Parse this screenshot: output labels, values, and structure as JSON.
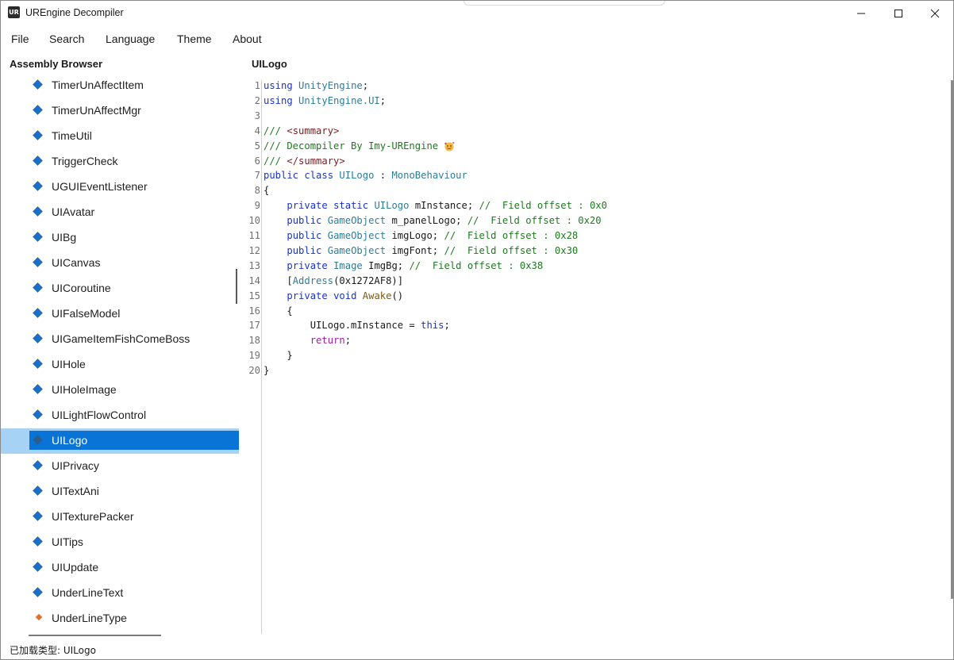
{
  "window": {
    "title": "UREngine Decompiler",
    "icon_text": "UR"
  },
  "menu": [
    "File",
    "Search",
    "Language",
    "Theme",
    "About"
  ],
  "assembly_browser": {
    "title": "Assembly Browser",
    "items": [
      {
        "label": "TimerUnAffectItem",
        "icon": "class-icon"
      },
      {
        "label": "TimerUnAffectMgr",
        "icon": "class-icon"
      },
      {
        "label": "TimeUtil",
        "icon": "class-icon"
      },
      {
        "label": "TriggerCheck",
        "icon": "class-icon"
      },
      {
        "label": "UGUIEventListener",
        "icon": "class-icon"
      },
      {
        "label": "UIAvatar",
        "icon": "class-icon"
      },
      {
        "label": "UIBg",
        "icon": "class-icon"
      },
      {
        "label": "UICanvas",
        "icon": "class-icon"
      },
      {
        "label": "UICoroutine",
        "icon": "class-icon"
      },
      {
        "label": "UIFalseModel",
        "icon": "class-icon"
      },
      {
        "label": "UIGameItemFishComeBoss",
        "icon": "class-icon"
      },
      {
        "label": "UIHole",
        "icon": "class-icon"
      },
      {
        "label": "UIHoleImage",
        "icon": "class-icon"
      },
      {
        "label": "UILightFlowControl",
        "icon": "class-icon"
      },
      {
        "label": "UILogo",
        "icon": "class-icon",
        "selected": true
      },
      {
        "label": "UIPrivacy",
        "icon": "class-icon"
      },
      {
        "label": "UITextAni",
        "icon": "class-icon"
      },
      {
        "label": "UITexturePacker",
        "icon": "class-icon"
      },
      {
        "label": "UITips",
        "icon": "class-icon"
      },
      {
        "label": "UIUpdate",
        "icon": "class-icon"
      },
      {
        "label": "UnderLineText",
        "icon": "class-icon"
      },
      {
        "label": "UnderLineType",
        "icon": "enum-icon"
      }
    ]
  },
  "document": {
    "title": "UILogo",
    "lines": [
      {
        "n": "1",
        "tokens": [
          [
            "kw",
            "using"
          ],
          [
            "pl",
            " "
          ],
          [
            "ty",
            "UnityEngine"
          ],
          [
            "pl",
            ";"
          ]
        ]
      },
      {
        "n": "2",
        "tokens": [
          [
            "kw",
            "using"
          ],
          [
            "pl",
            " "
          ],
          [
            "ty",
            "UnityEngine.UI"
          ],
          [
            "pl",
            ";"
          ]
        ]
      },
      {
        "n": "3",
        "tokens": []
      },
      {
        "n": "4",
        "tokens": [
          [
            "cm",
            "/// "
          ],
          [
            "xml",
            "<summary>"
          ]
        ]
      },
      {
        "n": "5",
        "tokens": [
          [
            "cm",
            "/// Decompiler By Imy-UREngine "
          ]
        ],
        "emoji": true
      },
      {
        "n": "6",
        "tokens": [
          [
            "cm",
            "/// "
          ],
          [
            "xml",
            "</summary>"
          ]
        ]
      },
      {
        "n": "7",
        "tokens": [
          [
            "kw",
            "public"
          ],
          [
            "pl",
            " "
          ],
          [
            "kw",
            "class"
          ],
          [
            "pl",
            " "
          ],
          [
            "ty",
            "UILogo"
          ],
          [
            "pl",
            " : "
          ],
          [
            "ty",
            "MonoBehaviour"
          ]
        ]
      },
      {
        "n": "8",
        "tokens": [
          [
            "pl",
            "{"
          ]
        ]
      },
      {
        "n": "9",
        "tokens": [
          [
            "pl",
            "    "
          ],
          [
            "kw",
            "private"
          ],
          [
            "pl",
            " "
          ],
          [
            "kw",
            "static"
          ],
          [
            "pl",
            " "
          ],
          [
            "ty",
            "UILogo"
          ],
          [
            "pl",
            " mInstance; "
          ],
          [
            "cm",
            "//  Field offset : 0x0"
          ]
        ]
      },
      {
        "n": "10",
        "tokens": [
          [
            "pl",
            "    "
          ],
          [
            "kw",
            "public"
          ],
          [
            "pl",
            " "
          ],
          [
            "ty",
            "GameObject"
          ],
          [
            "pl",
            " m_panelLogo; "
          ],
          [
            "cm",
            "//  Field offset : 0x20"
          ]
        ]
      },
      {
        "n": "11",
        "tokens": [
          [
            "pl",
            "    "
          ],
          [
            "kw",
            "public"
          ],
          [
            "pl",
            " "
          ],
          [
            "ty",
            "GameObject"
          ],
          [
            "pl",
            " imgLogo; "
          ],
          [
            "cm",
            "//  Field offset : 0x28"
          ]
        ]
      },
      {
        "n": "12",
        "tokens": [
          [
            "pl",
            "    "
          ],
          [
            "kw",
            "public"
          ],
          [
            "pl",
            " "
          ],
          [
            "ty",
            "GameObject"
          ],
          [
            "pl",
            " imgFont; "
          ],
          [
            "cm",
            "//  Field offset : 0x30"
          ]
        ]
      },
      {
        "n": "13",
        "tokens": [
          [
            "pl",
            "    "
          ],
          [
            "kw",
            "private"
          ],
          [
            "pl",
            " "
          ],
          [
            "ty",
            "Image"
          ],
          [
            "pl",
            " ImgBg; "
          ],
          [
            "cm",
            "//  Field offset : 0x38"
          ]
        ]
      },
      {
        "n": "14",
        "tokens": [
          [
            "pl",
            "    ["
          ],
          [
            "ty",
            "Address"
          ],
          [
            "pl",
            "(0x1272AF8)]"
          ]
        ]
      },
      {
        "n": "15",
        "tokens": [
          [
            "pl",
            "    "
          ],
          [
            "kw",
            "private"
          ],
          [
            "pl",
            " "
          ],
          [
            "kw",
            "void"
          ],
          [
            "pl",
            " "
          ],
          [
            "mt",
            "Awake"
          ],
          [
            "pl",
            "()"
          ]
        ]
      },
      {
        "n": "16",
        "tokens": [
          [
            "pl",
            "    {"
          ]
        ]
      },
      {
        "n": "17",
        "tokens": [
          [
            "pl",
            "        UILogo.mInstance = "
          ],
          [
            "kw",
            "this"
          ],
          [
            "pl",
            ";"
          ]
        ]
      },
      {
        "n": "18",
        "tokens": [
          [
            "pl",
            "        "
          ],
          [
            "ctl",
            "return"
          ],
          [
            "pl",
            ";"
          ]
        ]
      },
      {
        "n": "19",
        "tokens": [
          [
            "pl",
            "    }"
          ]
        ]
      },
      {
        "n": "20",
        "tokens": [
          [
            "pl",
            "}"
          ]
        ]
      }
    ]
  },
  "status": {
    "text": "已加载类型: UILogo"
  },
  "colors": {
    "selection": "#0a73d6",
    "selection_outer": "#a6d3f5",
    "class_icon": "#1a6fc4",
    "enum_icon": "#e0702a"
  }
}
